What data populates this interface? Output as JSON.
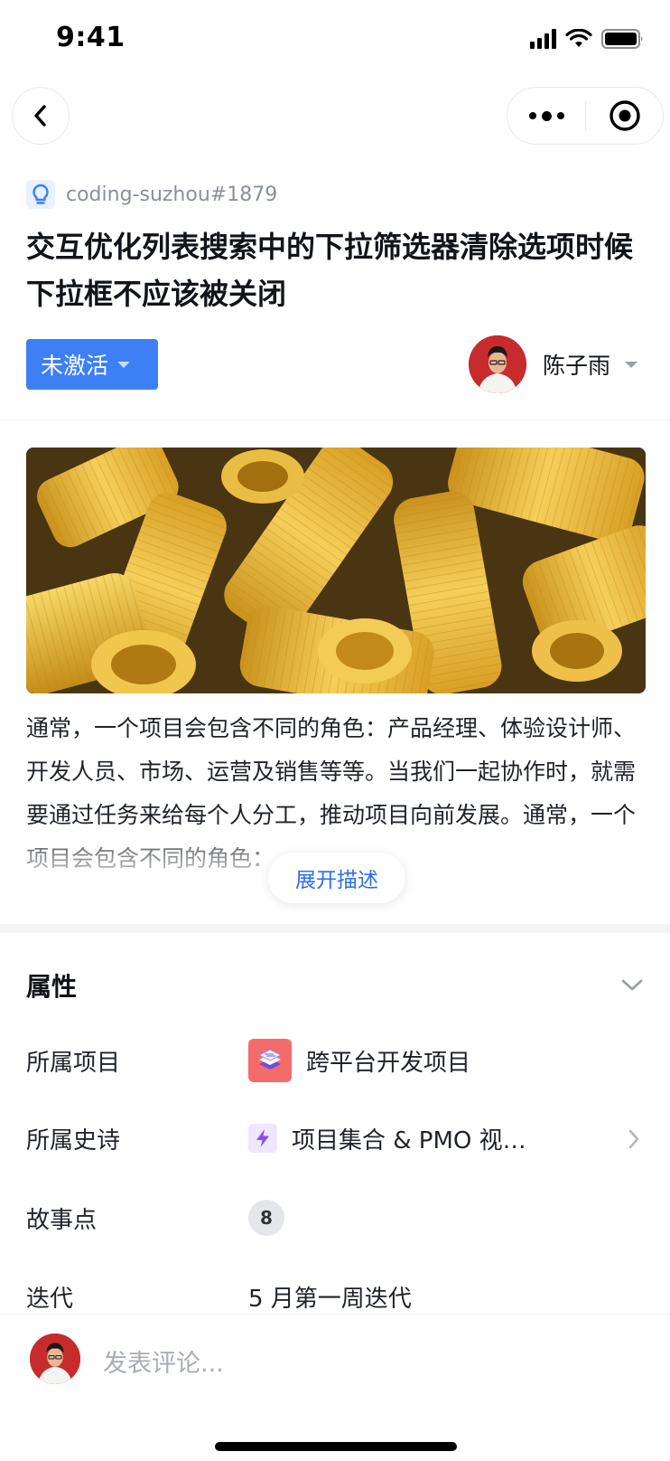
{
  "status_bar": {
    "time": "9:41"
  },
  "nav": {
    "back_icon": "chevron-left-icon",
    "more_icon": "more-dots-icon",
    "close_icon": "target-circle-icon"
  },
  "issue": {
    "type_icon": "lightbulb-icon",
    "id": "coding-suzhou#1879",
    "title": "交互优化列表搜索中的下拉筛选器清除选项时候下拉框不应该被关闭",
    "status": "未激活",
    "assignee": "陈子雨"
  },
  "description": {
    "text": "通常，一个项目会包含不同的角色：产品经理、体验设计师、开发人员、市场、运营及销售等等。当我们一起协作时，就需要通过任务来给每个人分工，推动项目向前发展。通常，一个项目会包含不同的角色：",
    "expand_label": "展开描述"
  },
  "attributes": {
    "title": "属性",
    "rows": [
      {
        "label": "所属项目",
        "value": "跨平台开发项目"
      },
      {
        "label": "所属史诗",
        "value": "项目集合 & PMO 视…"
      },
      {
        "label": "故事点",
        "value": "8"
      },
      {
        "label": "迭代",
        "value": "5 月第一周迭代"
      }
    ]
  },
  "comment": {
    "placeholder": "发表评论..."
  },
  "colors": {
    "accent": "#3d7ff5",
    "link": "#2b6fe8",
    "project_icon_bg": "#f46b6b",
    "epic_icon": "#8a4cf0"
  }
}
